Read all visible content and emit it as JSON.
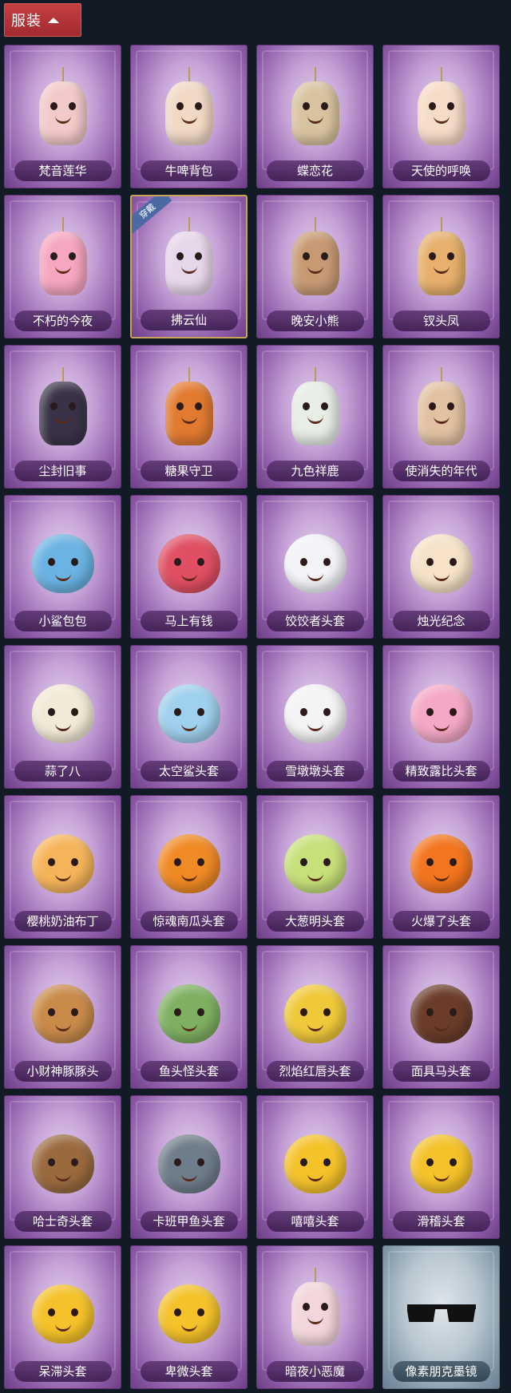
{
  "header": {
    "title": "服装",
    "toggle_icon": "chevron-up-icon"
  },
  "badge_text": "穿戴",
  "items": [
    {
      "name": "梵音莲华",
      "color": "#f3c9c9",
      "style": "figure"
    },
    {
      "name": "牛啤背包",
      "color": "#f1d9c6",
      "style": "figure"
    },
    {
      "name": "蝶恋花",
      "color": "#d8c3a0",
      "style": "figure"
    },
    {
      "name": "天使的呼唤",
      "color": "#f6dcc8",
      "style": "figure"
    },
    {
      "name": "不朽的今夜",
      "color": "#f6a6c0",
      "style": "figure"
    },
    {
      "name": "拂云仙",
      "color": "#e8d6ea",
      "style": "figure",
      "equipped": true
    },
    {
      "name": "晚安小熊",
      "color": "#c79a74",
      "style": "figure"
    },
    {
      "name": "钗头凤",
      "color": "#e7b06c",
      "style": "figure"
    },
    {
      "name": "尘封旧事",
      "color": "#3a3348",
      "style": "figure"
    },
    {
      "name": "糖果守卫",
      "color": "#e27a30",
      "style": "figure"
    },
    {
      "name": "九色祥鹿",
      "color": "#e8ede6",
      "style": "figure"
    },
    {
      "name": "使消失的年代",
      "color": "#e2c1a2",
      "style": "figure"
    },
    {
      "name": "小鲨包包",
      "color": "#6bb3e3",
      "style": "blob"
    },
    {
      "name": "马上有钱",
      "color": "#e04f63",
      "style": "blob"
    },
    {
      "name": "饺饺者头套",
      "color": "#f2f4f8",
      "style": "blob"
    },
    {
      "name": "烛光纪念",
      "color": "#f5e2c8",
      "style": "blob"
    },
    {
      "name": "蒜了八",
      "color": "#f2ead6",
      "style": "blob"
    },
    {
      "name": "太空鲨头套",
      "color": "#9fd0ee",
      "style": "blob"
    },
    {
      "name": "雪墩墩头套",
      "color": "#f4f4f6",
      "style": "blob"
    },
    {
      "name": "精致露比头套",
      "color": "#f4a7c6",
      "style": "blob"
    },
    {
      "name": "樱桃奶油布丁",
      "color": "#f6b45a",
      "style": "blob"
    },
    {
      "name": "惊魂南瓜头套",
      "color": "#f08a25",
      "style": "blob"
    },
    {
      "name": "大葱明头套",
      "color": "#c7e07a",
      "style": "blob"
    },
    {
      "name": "火爆了头套",
      "color": "#f3751f",
      "style": "blob"
    },
    {
      "name": "小财神豚豚头",
      "color": "#c98a4a",
      "style": "blob"
    },
    {
      "name": "鱼头怪头套",
      "color": "#7fb061",
      "style": "blob"
    },
    {
      "name": "烈焰红唇头套",
      "color": "#f0c93a",
      "style": "blob"
    },
    {
      "name": "面具马头套",
      "color": "#6b3c2a",
      "style": "blob"
    },
    {
      "name": "哈士奇头套",
      "color": "#9a6a3f",
      "style": "blob"
    },
    {
      "name": "卡班甲鱼头套",
      "color": "#6f7d8a",
      "style": "blob"
    },
    {
      "name": "嘻嘻头套",
      "color": "#f5c22a",
      "style": "blob"
    },
    {
      "name": "滑稽头套",
      "color": "#f5c22a",
      "style": "blob"
    },
    {
      "name": "呆滞头套",
      "color": "#f5c22a",
      "style": "blob"
    },
    {
      "name": "卑微头套",
      "color": "#f5c22a",
      "style": "blob"
    },
    {
      "name": "暗夜小恶魔",
      "color": "#f2d6dc",
      "style": "figure"
    },
    {
      "name": "像素朋克墨镜",
      "color": "#111111",
      "style": "glasses",
      "variant": "cyan"
    }
  ]
}
